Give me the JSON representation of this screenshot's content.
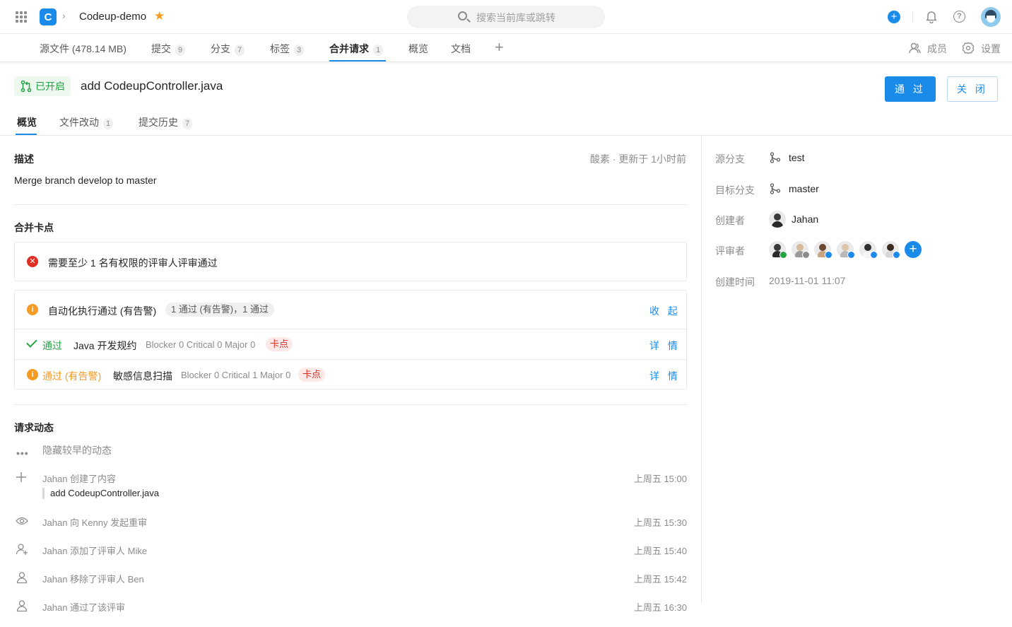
{
  "topbar": {
    "repo_name": "Codeup-demo",
    "search_placeholder": "搜索当前库或跳转"
  },
  "repo_nav": {
    "items": [
      {
        "label": "源文件 (478.14 MB)"
      },
      {
        "label": "提交",
        "count": "9"
      },
      {
        "label": "分支",
        "count": "7"
      },
      {
        "label": "标签",
        "count": "3"
      },
      {
        "label": "合并请求",
        "count": "1",
        "active": true
      },
      {
        "label": "概览"
      },
      {
        "label": "文档"
      }
    ],
    "members_label": "成员",
    "settings_label": "设置"
  },
  "mr": {
    "status": "已开启",
    "title": "add CodeupController.java",
    "approve_label": "通 过",
    "close_label": "关 闭",
    "tabs": [
      {
        "label": "概览",
        "active": true
      },
      {
        "label": "文件改动",
        "count": "1"
      },
      {
        "label": "提交历史",
        "count": "7"
      }
    ]
  },
  "description": {
    "title": "描述",
    "meta": "酸素 · 更新于 1小时前",
    "text": "Merge branch develop to master"
  },
  "merge_gate": {
    "title": "合并卡点",
    "blocker_text": "需要至少 1 名有权限的评审人评审通过",
    "auto_title": "自动化执行通过 (有告警)",
    "auto_summary": "1 通过 (有告警)，1 通过",
    "collapse_label": "收 起",
    "rules": [
      {
        "status": "通过",
        "name": "Java 开发规约",
        "stats": "Blocker 0 Critical 0 Major 0",
        "tag": "卡点",
        "detail": "详 情"
      },
      {
        "status": "通过 (有告警)",
        "name": "敏感信息扫描",
        "stats": "Blocker 0 Critical 1 Major 0",
        "tag": "卡点",
        "detail": "详 情"
      }
    ]
  },
  "activity": {
    "title": "请求动态",
    "hide_label": "隐藏较早的动态",
    "items": [
      {
        "text": "Jahan 创建了内容",
        "time": "上周五 15:00",
        "quote": "add CodeupController.java"
      },
      {
        "text": "Jahan 向 Kenny 发起重审",
        "time": "上周五 15:30"
      },
      {
        "text": "Jahan 添加了评审人 Mike",
        "time": "上周五 15:40"
      },
      {
        "text": "Jahan 移除了评审人 Ben",
        "time": "上周五 15:42"
      },
      {
        "text": "Jahan 通过了该评审",
        "time": "上周五 16:30"
      }
    ]
  },
  "panel": {
    "source_label": "源分支",
    "source_value": "test",
    "target_label": "目标分支",
    "target_value": "master",
    "creator_label": "创建者",
    "creator_value": "Jahan",
    "reviewers_label": "评审者",
    "created_label": "创建时间",
    "created_value": "2019-11-01 11:07"
  },
  "colors": {
    "accent": "#1b8bea",
    "success": "#25a244",
    "warning": "#f59a23",
    "danger": "#e02e24"
  }
}
